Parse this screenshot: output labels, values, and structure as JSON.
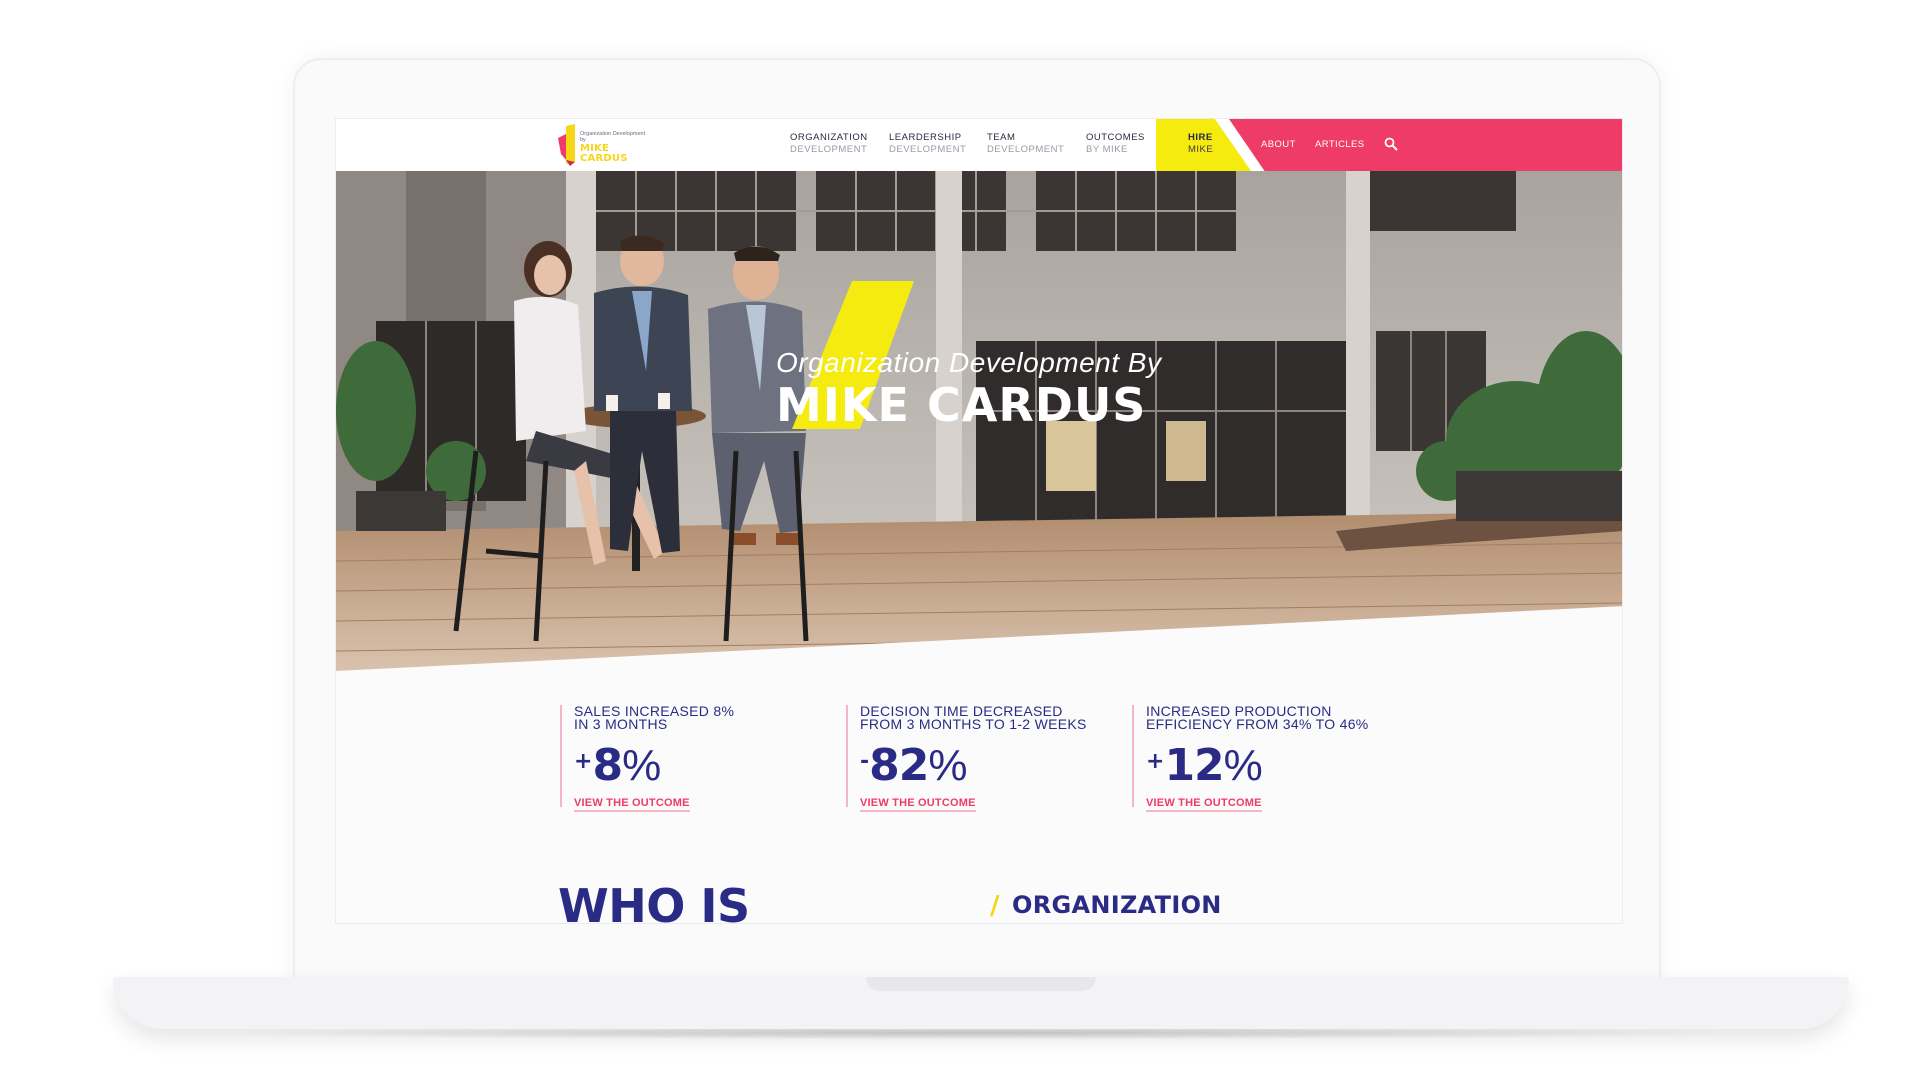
{
  "logo": {
    "small_text": "Organization Development by",
    "name_line1": "MIKE",
    "name_line2": "CARDUS"
  },
  "nav": {
    "items": [
      {
        "line1": "ORGANIZATION",
        "line2": "DEVELOPMENT"
      },
      {
        "line1": "LEARDERSHIP",
        "line2": "DEVELOPMENT"
      },
      {
        "line1": "TEAM",
        "line2": "DEVELOPMENT"
      },
      {
        "line1": "OUTCOMES",
        "line2": "BY MIKE"
      }
    ],
    "hire": {
      "line1": "HIRE",
      "line2": "MIKE"
    },
    "about": "ABOUT",
    "articles": "ARTICLES"
  },
  "hero": {
    "subtitle": "Organization Development By",
    "title": "MIKE CARDUS"
  },
  "stats": [
    {
      "label_line1": "SALES INCREASED 8%",
      "label_line2": "IN 3 MONTHS",
      "sign": "+",
      "number": "8",
      "unit": "%",
      "link": "VIEW THE OUTCOME"
    },
    {
      "label_line1": "DECISION TIME DECREASED",
      "label_line2": "FROM 3 MONTHS TO 1-2 WEEKS",
      "sign": "-",
      "number": "82",
      "unit": "%",
      "link": "VIEW THE OUTCOME"
    },
    {
      "label_line1": "INCREASED PRODUCTION",
      "label_line2": "EFFICIENCY FROM 34% TO 46%",
      "sign": "+",
      "number": "12",
      "unit": "%",
      "link": "VIEW THE OUTCOME"
    }
  ],
  "sections": {
    "who_heading": "WHO IS",
    "org_heading": "ORGANIZATION"
  },
  "colors": {
    "accent_pink": "#ee3b67",
    "accent_yellow": "#f5eb0e",
    "navy": "#2a2b85"
  },
  "icons": {
    "search": "search-icon"
  }
}
